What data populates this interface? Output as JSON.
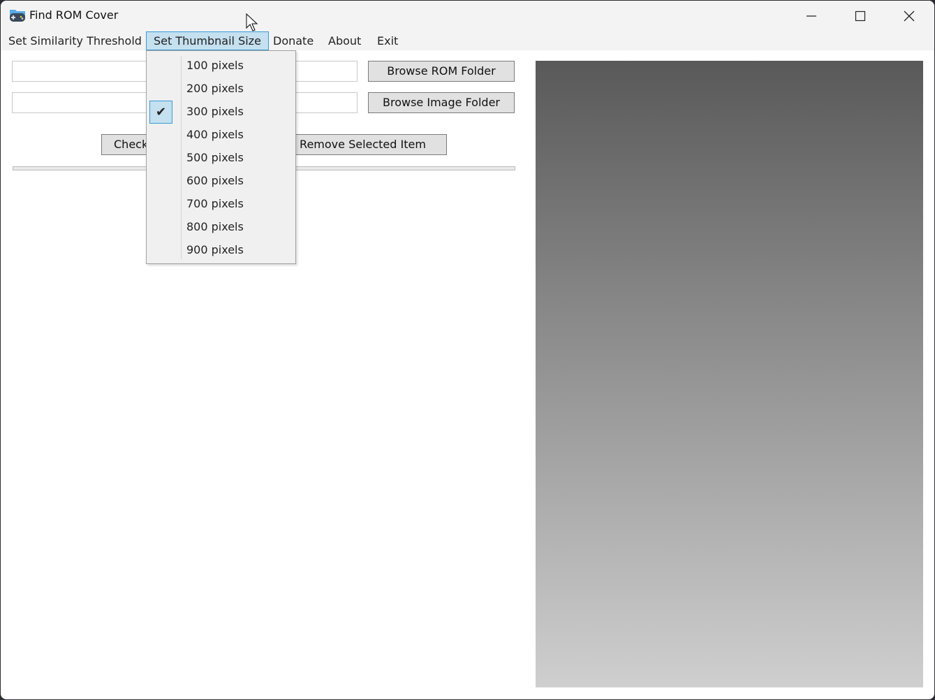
{
  "window": {
    "title": "Find ROM Cover",
    "icon": "gamepad-folder-icon"
  },
  "menu": {
    "items": [
      "Set Similarity Threshold",
      "Set Thumbnail Size",
      "Donate",
      "About",
      "Exit"
    ],
    "active": "Set Thumbnail Size"
  },
  "thumbnail_menu": {
    "options": [
      "100 pixels",
      "200 pixels",
      "300 pixels",
      "400 pixels",
      "500 pixels",
      "600 pixels",
      "700 pixels",
      "800 pixels",
      "900 pixels"
    ],
    "checked": "300 pixels"
  },
  "form": {
    "rom_folder_value": "",
    "image_folder_value": "",
    "browse_rom_label": "Browse ROM Folder",
    "browse_image_label": "Browse Image Folder",
    "check_label": "Check",
    "remove_label": "Remove Selected Item"
  },
  "progress": {
    "value": 0
  },
  "colors": {
    "accent": "#3a9ad6",
    "highlight": "#c5e0ef"
  }
}
